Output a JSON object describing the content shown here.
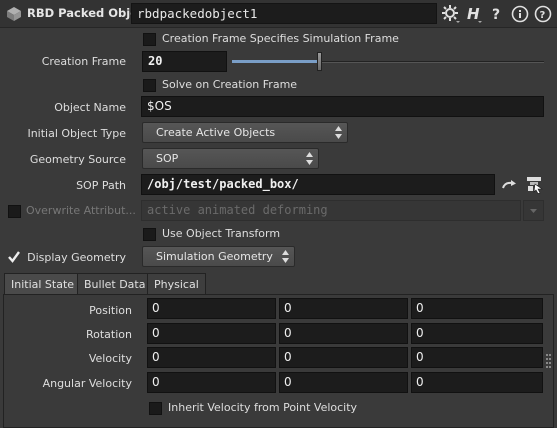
{
  "header": {
    "node_type": "RBD Packed Object",
    "node_name": "rbdpackedobject1",
    "icons": [
      "rbd-packed-node-icon",
      "gear-icon",
      "houdini-h-icon",
      "help-question-icon",
      "info-icon",
      "help-icon"
    ]
  },
  "params": {
    "creation_frame_specifies": "Creation Frame Specifies Simulation Frame",
    "creation_frame_label": "Creation Frame",
    "creation_frame_value": "20",
    "creation_frame_slider_fraction": 0.28,
    "solve_on_creation": "Solve on Creation Frame",
    "object_name_label": "Object Name",
    "object_name_value": "$OS",
    "initial_object_type_label": "Initial Object Type",
    "initial_object_type_value": "Create Active Objects",
    "geometry_source_label": "Geometry Source",
    "geometry_source_value": "SOP",
    "sop_path_label": "SOP Path",
    "sop_path_value": "/obj/test/packed_box/",
    "overwrite_label": "Overwrite Attribut...",
    "overwrite_value": "active animated deforming",
    "use_object_transform": "Use Object Transform",
    "display_geometry_label": "Display Geometry",
    "display_geometry_value": "Simulation Geometry"
  },
  "tabs": [
    {
      "label": "Initial State",
      "active": true
    },
    {
      "label": "Bullet Data",
      "active": false
    },
    {
      "label": "Physical",
      "active": false
    }
  ],
  "initial_state": {
    "rows": [
      {
        "label": "Position",
        "values": [
          "0",
          "0",
          "0"
        ]
      },
      {
        "label": "Rotation",
        "values": [
          "0",
          "0",
          "0"
        ]
      },
      {
        "label": "Velocity",
        "values": [
          "0",
          "0",
          "0"
        ]
      },
      {
        "label": "Angular Velocity",
        "values": [
          "0",
          "0",
          "0"
        ]
      }
    ],
    "inherit_velocity": "Inherit Velocity from Point Velocity"
  }
}
